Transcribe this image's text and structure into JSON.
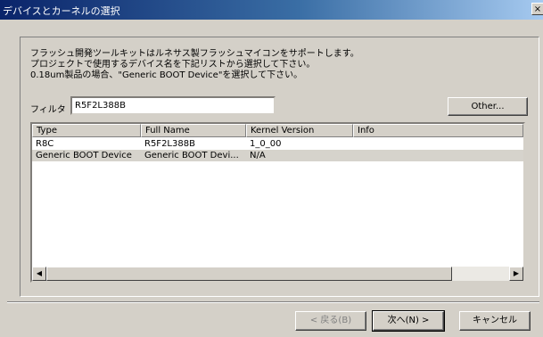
{
  "window": {
    "title": "デバイスとカーネルの選択",
    "close_label": "×"
  },
  "description": {
    "line1": "フラッシュ開発ツールキットはルネサス製フラッシュマイコンをサポートします。",
    "line2": "プロジェクトで使用するデバイス名を下記リストから選択して下さい。",
    "line3": "0.18um製品の場合、\"Generic BOOT Device\"を選択して下さい。"
  },
  "filter": {
    "label": "フィルタ",
    "value": "R5F2L388B"
  },
  "buttons": {
    "other": "Other...",
    "back": "< 戻る(B)",
    "next": "次へ(N) >",
    "cancel": "キャンセル"
  },
  "table": {
    "columns": [
      "Type",
      "Full Name",
      "Kernel Version",
      "Info"
    ],
    "rows": [
      {
        "type": "R8C",
        "full_name": "R5F2L388B",
        "kernel_version": "1_0_00",
        "info": ""
      },
      {
        "type": "Generic BOOT Device",
        "full_name": "Generic BOOT Devi...",
        "kernel_version": "N/A",
        "info": ""
      }
    ]
  }
}
